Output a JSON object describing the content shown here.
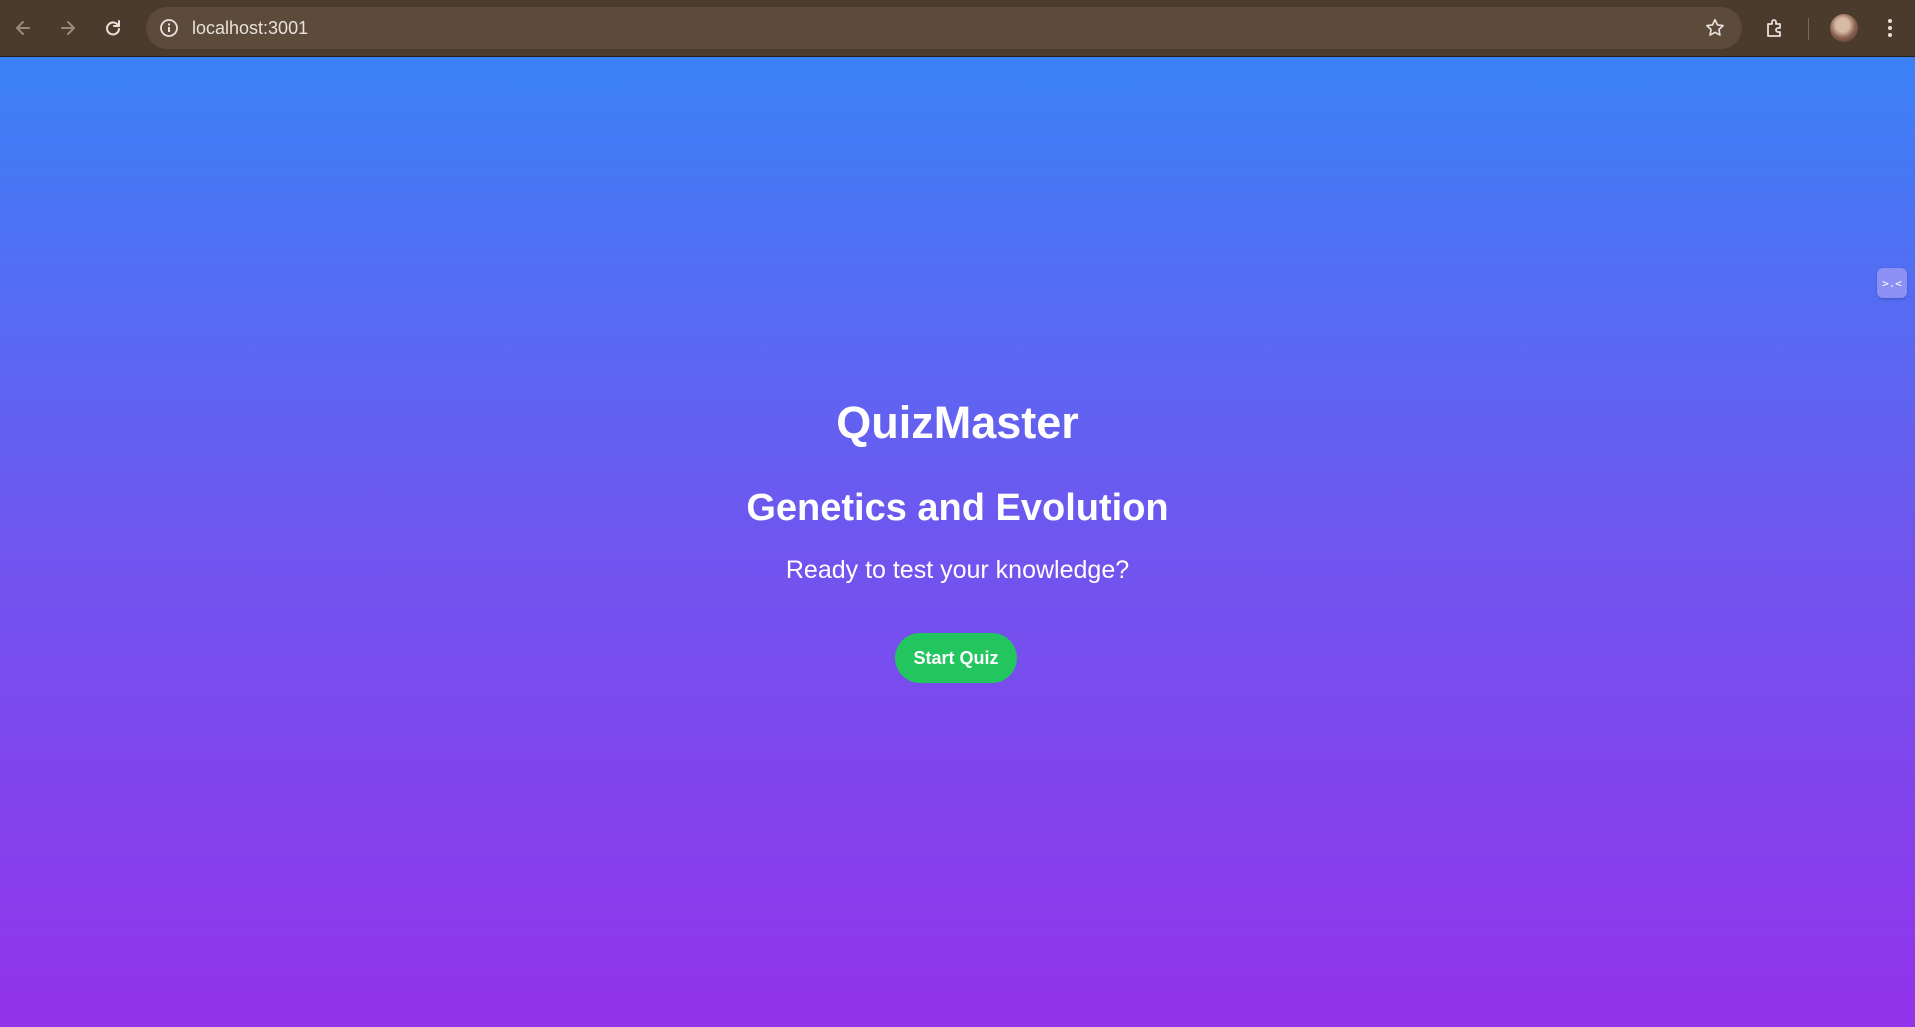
{
  "browser": {
    "url": "localhost:3001",
    "icons": {
      "back": "back-arrow-icon",
      "forward": "forward-arrow-icon",
      "reload": "reload-icon",
      "info": "site-info-icon",
      "bookmark": "star-icon",
      "extensions": "puzzle-icon",
      "profile": "avatar",
      "menu": "kebab-menu-icon"
    }
  },
  "page": {
    "app_title": "QuizMaster",
    "quiz_topic": "Genetics and Evolution",
    "prompt": "Ready to test your knowledge?",
    "start_button_label": "Start Quiz",
    "side_widget_glyph": ">.<"
  },
  "colors": {
    "gradient_top": "#3b82f6",
    "gradient_bottom": "#9333ea",
    "button": "#22c55e",
    "browser_bar": "#4b3b2d"
  }
}
